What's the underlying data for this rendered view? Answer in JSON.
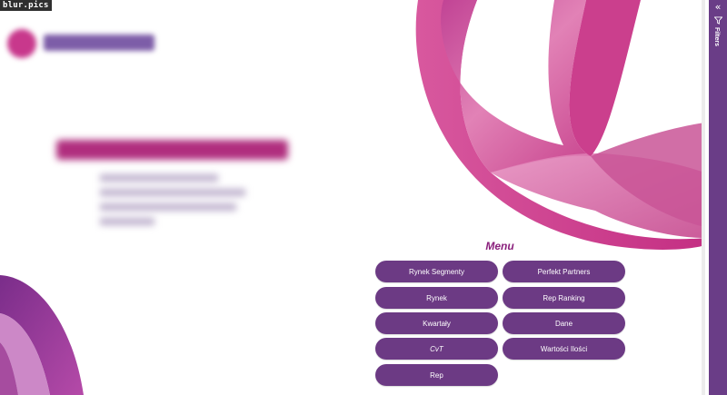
{
  "watermark": "blur.pics",
  "menu": {
    "title": "Menu",
    "buttons": [
      {
        "label": "Rynek Segmenty"
      },
      {
        "label": "Perfekt Partners"
      },
      {
        "label": "Rynek"
      },
      {
        "label": "Rep Ranking"
      },
      {
        "label": "Kwartały"
      },
      {
        "label": "Dane"
      },
      {
        "label": "CvT"
      },
      {
        "label": "Wartości Ilości"
      },
      {
        "label": "Rep"
      }
    ]
  },
  "filters_pane": {
    "label": "Filters",
    "collapse_icon": "double-chevron-left-icon",
    "filter_icon": "funnel-icon"
  },
  "colors": {
    "accent_purple": "#6c3a84",
    "pane_purple": "#6a3d87",
    "magenta": "#c8388c",
    "title_purple": "#8a1f7c"
  }
}
